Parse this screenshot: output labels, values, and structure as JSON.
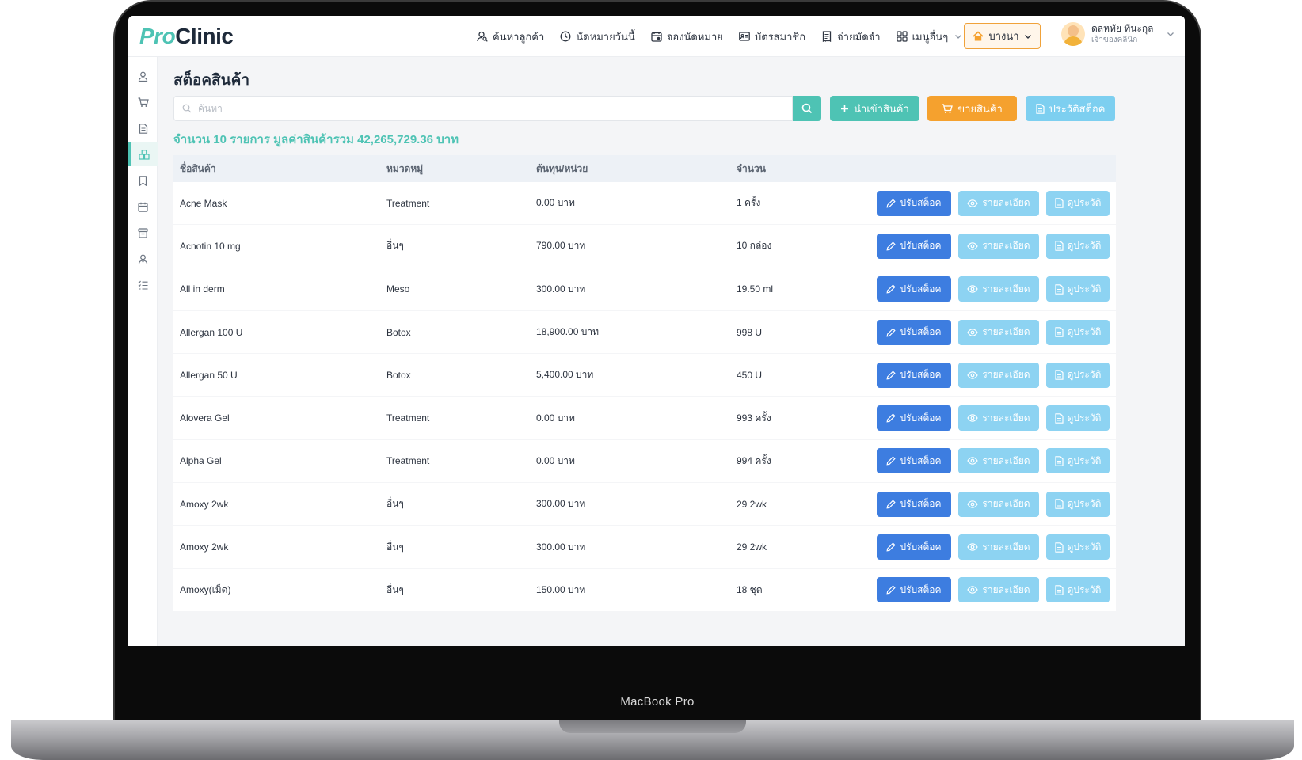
{
  "device": {
    "label": "MacBook Pro"
  },
  "logo": {
    "part1": "Pro",
    "part2": "Clinic"
  },
  "nav": [
    {
      "label": "ค้นหาลูกค้า",
      "icon": "user-search-icon"
    },
    {
      "label": "นัดหมายวันนี้",
      "icon": "clock-icon"
    },
    {
      "label": "จองนัดหมาย",
      "icon": "calendar-icon"
    },
    {
      "label": "บัตรสมาชิก",
      "icon": "id-card-icon"
    },
    {
      "label": "จ่ายมัดจำ",
      "icon": "receipt-icon"
    },
    {
      "label": "เมนูอื่นๆ",
      "icon": "grid-icon"
    }
  ],
  "branch": {
    "label": "บางนา",
    "icon": "home-icon"
  },
  "user": {
    "name": "ดลหทัย ทีนะกุล",
    "role": "เจ้าของคลินิก"
  },
  "sidebar": [
    {
      "icon": "user-icon",
      "active": false
    },
    {
      "icon": "cart-icon",
      "active": false
    },
    {
      "icon": "document-icon",
      "active": false
    },
    {
      "icon": "stock-icon",
      "active": true
    },
    {
      "icon": "bookmark-icon",
      "active": false
    },
    {
      "icon": "calendar-icon",
      "active": false
    },
    {
      "icon": "database-icon",
      "active": false
    },
    {
      "icon": "staff-icon",
      "active": false
    },
    {
      "icon": "list-icon",
      "active": false
    }
  ],
  "page": {
    "title": "สต็อคสินค้า"
  },
  "search": {
    "placeholder": "ค้นหา"
  },
  "actions": {
    "import": "นำเข้าสินค้า",
    "sell": "ขายสินค้า",
    "history": "ประวัติสต็อค"
  },
  "summary": "จำนวน 10 รายการ มูลค่าสินค้ารวม 42,265,729.36 บาท",
  "table": {
    "headers": {
      "name": "ชื่อสินค้า",
      "category": "หมวดหมู่",
      "cost": "ต้นทุน/หน่วย",
      "qty": "จำนวน"
    },
    "row_actions": {
      "adjust": "ปรับสต็อค",
      "detail": "รายละเอียด",
      "history": "ดูประวัติ"
    },
    "rows": [
      {
        "name": "Acne Mask",
        "category": "Treatment",
        "cost": "0.00 บาท",
        "qty": "1 ครั้ง"
      },
      {
        "name": "Acnotin 10 mg",
        "category": "อื่นๆ",
        "cost": "790.00 บาท",
        "qty": "10 กล่อง"
      },
      {
        "name": "All in derm",
        "category": "Meso",
        "cost": "300.00 บาท",
        "qty": "19.50 ml"
      },
      {
        "name": "Allergan 100 U",
        "category": "Botox",
        "cost": "18,900.00 บาท",
        "qty": "998 U"
      },
      {
        "name": "Allergan 50 U",
        "category": "Botox",
        "cost": "5,400.00 บาท",
        "qty": "450 U"
      },
      {
        "name": "Alovera Gel",
        "category": "Treatment",
        "cost": "0.00 บาท",
        "qty": "993 ครั้ง"
      },
      {
        "name": "Alpha Gel",
        "category": "Treatment",
        "cost": "0.00 บาท",
        "qty": "994 ครั้ง"
      },
      {
        "name": "Amoxy 2wk",
        "category": "อื่นๆ",
        "cost": "300.00 บาท",
        "qty": "29 2wk"
      },
      {
        "name": "Amoxy 2wk",
        "category": "อื่นๆ",
        "cost": "300.00 บาท",
        "qty": "29 2wk"
      },
      {
        "name": "Amoxy(เม็ด)",
        "category": "อื่นๆ",
        "cost": "150.00 บาท",
        "qty": "18 ชุด"
      }
    ]
  },
  "colors": {
    "accent": "#4ec3b4",
    "primary": "#3d7de0",
    "orange": "#f5a12e",
    "lightblue": "#8dd3f2"
  }
}
